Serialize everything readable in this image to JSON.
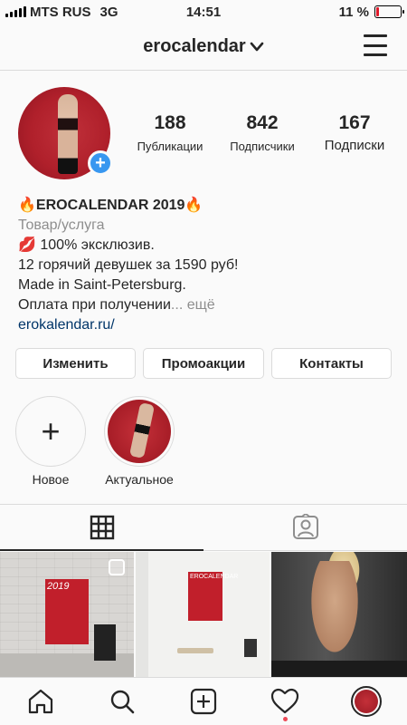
{
  "status_bar": {
    "carrier": "MTS RUS",
    "network": "3G",
    "time": "14:51",
    "battery_percent": "11 %",
    "battery_level": 0.11,
    "battery_color": "#e0192a"
  },
  "header": {
    "username": "erocalendar",
    "dropdown_icon": "chevron-down-icon",
    "menu_icon": "hamburger-menu-icon"
  },
  "profile": {
    "avatar_badge": "+",
    "stats": [
      {
        "value": "188",
        "label": "Публикации"
      },
      {
        "value": "842",
        "label": "Подписчики"
      },
      {
        "value": "167",
        "label": "Подписки"
      }
    ]
  },
  "bio": {
    "name": "🔥EROCALENDAR 2019🔥",
    "category": "Товар/услуга",
    "line1": "💋 100% эксклюзив.",
    "line2": "12 горячий девушек за 1590 руб!",
    "line3": "Made in Saint-Petersburg.",
    "line4": "Оплата при получении",
    "more": "... ещё",
    "link": "erokalendar.ru/"
  },
  "buttons": {
    "edit": "Изменить",
    "promo": "Промоакции",
    "contacts": "Контакты"
  },
  "highlights": [
    {
      "label": "Новое",
      "icon": "plus-icon"
    },
    {
      "label": "Актуальное"
    }
  ],
  "tabs": {
    "grid_icon": "grid-icon",
    "tagged_icon": "tagged-person-icon",
    "active": "grid"
  },
  "posts": {
    "post1_text": "2019",
    "post2_text": "EROCALENDAR"
  },
  "bottom_nav": {
    "home": "home-icon",
    "search": "search-icon",
    "add": "add-post-icon",
    "activity": "heart-icon",
    "profile": "profile-avatar",
    "notification_color": "#ed4956"
  },
  "colors": {
    "link": "#003569",
    "badge": "#3897f0",
    "muted": "#8e8e8e"
  }
}
